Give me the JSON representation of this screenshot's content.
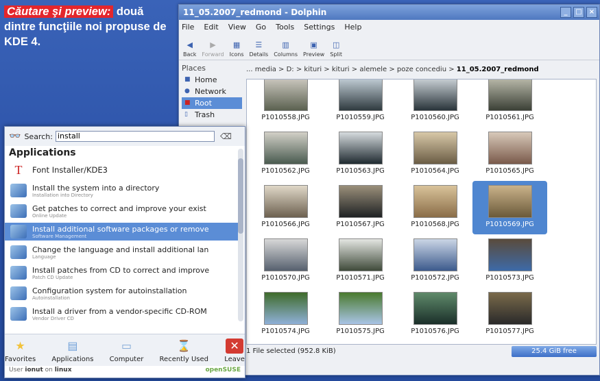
{
  "caption": {
    "highlight": "Căutare şi preview:",
    "text": " două dintre funcţiile noi propuse de KDE 4."
  },
  "dolphin": {
    "title": "11_05.2007_redmond - Dolphin",
    "menu": [
      "File",
      "Edit",
      "View",
      "Go",
      "Tools",
      "Settings",
      "Help"
    ],
    "toolbar": [
      {
        "label": "Back",
        "icon": "back-arrow-icon",
        "enabled": true
      },
      {
        "label": "Forward",
        "icon": "forward-arrow-icon",
        "enabled": false
      },
      {
        "label": "Icons",
        "icon": "icons-view-icon",
        "enabled": true
      },
      {
        "label": "Details",
        "icon": "details-view-icon",
        "enabled": true
      },
      {
        "label": "Columns",
        "icon": "columns-view-icon",
        "enabled": true
      },
      {
        "label": "Preview",
        "icon": "preview-icon",
        "enabled": true
      },
      {
        "label": "Split",
        "icon": "split-view-icon",
        "enabled": true
      }
    ],
    "places_header": "Places",
    "places": [
      {
        "label": "Home",
        "icon": "home-icon",
        "selected": false
      },
      {
        "label": "Network",
        "icon": "network-icon",
        "selected": false
      },
      {
        "label": "Root",
        "icon": "root-folder-icon",
        "selected": true
      },
      {
        "label": "Trash",
        "icon": "trash-icon",
        "selected": false
      }
    ],
    "breadcrumb": "... media > D: > kituri > kituri > alemele > poze concediu > ",
    "breadcrumb_current": "11_05.2007_redmond",
    "files": [
      {
        "name": "P1010558.JPG",
        "c1": "#5b6150",
        "c2": "#c9c6bd"
      },
      {
        "name": "P1010559.JPG",
        "c1": "#2f3a3f",
        "c2": "#bfcbd3"
      },
      {
        "name": "P1010560.JPG",
        "c1": "#29343a",
        "c2": "#c8cfd4"
      },
      {
        "name": "P1010561.JPG",
        "c1": "#3b4036",
        "c2": "#b7b7a8"
      },
      {
        "name": "P1010562.JPG",
        "c1": "#4a5b50",
        "c2": "#d2d0c7"
      },
      {
        "name": "P1010563.JPG",
        "c1": "#1f2a30",
        "c2": "#d6dbde"
      },
      {
        "name": "P1010564.JPG",
        "c1": "#6b5d45",
        "c2": "#d8c8a8"
      },
      {
        "name": "P1010565.JPG",
        "c1": "#7a5a4b",
        "c2": "#d8c9b9"
      },
      {
        "name": "P1010566.JPG",
        "c1": "#6d6150",
        "c2": "#e0d8c8"
      },
      {
        "name": "P1010567.JPG",
        "c1": "#1f2224",
        "c2": "#9a8f7a"
      },
      {
        "name": "P1010568.JPG",
        "c1": "#8a6d48",
        "c2": "#d9c39a"
      },
      {
        "name": "P1010569.JPG",
        "c1": "#6b5a3a",
        "c2": "#c9b28a"
      },
      {
        "name": "P1010570.JPG",
        "c1": "#56606e",
        "c2": "#d8d8d8"
      },
      {
        "name": "P1010571.JPG",
        "c1": "#3f4a3a",
        "c2": "#e4e6e2"
      },
      {
        "name": "P1010572.JPG",
        "c1": "#3c5a8c",
        "c2": "#cbd6e6"
      },
      {
        "name": "P1010573.JPG",
        "c1": "#3d6aa8",
        "c2": "#5a4b3c"
      },
      {
        "name": "P1010574.JPG",
        "c1": "#8fb0d8",
        "c2": "#3f6b2a"
      },
      {
        "name": "P1010575.JPG",
        "c1": "#a9c4e6",
        "c2": "#4a7a2e"
      },
      {
        "name": "P1010576.JPG",
        "c1": "#1b2f2a",
        "c2": "#5f8a6a"
      },
      {
        "name": "P1010577.JPG",
        "c1": "#2a2a2a",
        "c2": "#7a6a4a"
      }
    ],
    "selected_file_index": 11,
    "status": "1 File selected (952.8 KiB)",
    "free_space": "25.4 GiB free"
  },
  "kmenu": {
    "search_label": "Search:",
    "search_value": "install",
    "section": "Applications",
    "apps": [
      {
        "name": "Font Installer/KDE3",
        "sub": "",
        "icon": "font-installer-icon",
        "selected": false
      },
      {
        "name": "Install the system into a directory",
        "sub": "Installation into Directory",
        "icon": "install-directory-icon",
        "selected": false
      },
      {
        "name": "Get patches to correct and improve your exist",
        "sub": "Online Update",
        "icon": "online-update-icon",
        "selected": false
      },
      {
        "name": "Install additional software packages or remove",
        "sub": "Software Management",
        "icon": "software-management-icon",
        "selected": true
      },
      {
        "name": "Change the language and install additional lan",
        "sub": "Language",
        "icon": "language-icon",
        "selected": false
      },
      {
        "name": "Install patches from CD to correct and improve",
        "sub": "Patch CD Update",
        "icon": "patch-cd-icon",
        "selected": false
      },
      {
        "name": "Configuration system for autoinstallation",
        "sub": "Autoinstallation",
        "icon": "autoinstall-icon",
        "selected": false
      },
      {
        "name": "Install a driver from a vendor-specific CD-ROM",
        "sub": "Vendor Driver CD",
        "icon": "vendor-driver-icon",
        "selected": false
      }
    ],
    "tabs": [
      {
        "label": "Favorites",
        "icon": "star-icon",
        "color": "#f2c23a"
      },
      {
        "label": "Applications",
        "icon": "applications-icon",
        "color": "#6f9fd8"
      },
      {
        "label": "Computer",
        "icon": "computer-icon",
        "color": "#7fa7d6"
      },
      {
        "label": "Recently Used",
        "icon": "hourglass-icon",
        "color": "#8a8a8a"
      },
      {
        "label": "Leave",
        "icon": "leave-icon",
        "color": "#d33b32"
      }
    ],
    "user_prefix": "User ",
    "user": "ionut",
    "user_mid": " on ",
    "host": "linux",
    "brand": "openSUSE"
  }
}
